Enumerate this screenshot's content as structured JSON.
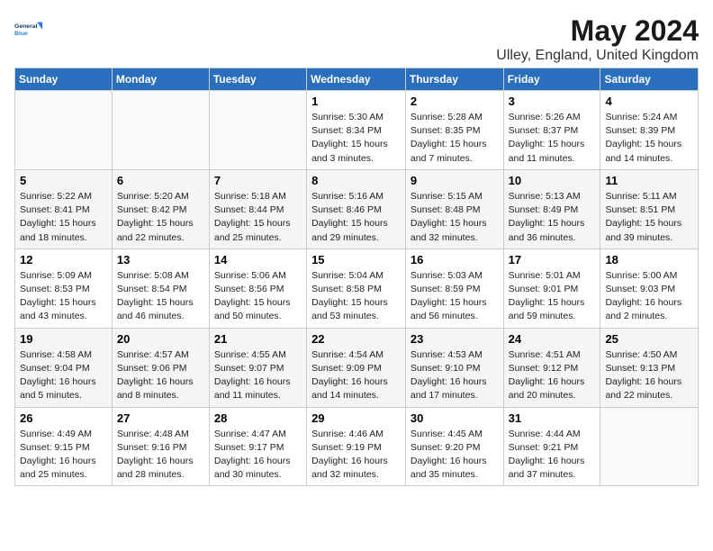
{
  "header": {
    "logo_line1": "General",
    "logo_line2": "Blue",
    "month_year": "May 2024",
    "location": "Ulley, England, United Kingdom"
  },
  "weekdays": [
    "Sunday",
    "Monday",
    "Tuesday",
    "Wednesday",
    "Thursday",
    "Friday",
    "Saturday"
  ],
  "weeks": [
    [
      {
        "day": "",
        "info": ""
      },
      {
        "day": "",
        "info": ""
      },
      {
        "day": "",
        "info": ""
      },
      {
        "day": "1",
        "info": "Sunrise: 5:30 AM\nSunset: 8:34 PM\nDaylight: 15 hours\nand 3 minutes."
      },
      {
        "day": "2",
        "info": "Sunrise: 5:28 AM\nSunset: 8:35 PM\nDaylight: 15 hours\nand 7 minutes."
      },
      {
        "day": "3",
        "info": "Sunrise: 5:26 AM\nSunset: 8:37 PM\nDaylight: 15 hours\nand 11 minutes."
      },
      {
        "day": "4",
        "info": "Sunrise: 5:24 AM\nSunset: 8:39 PM\nDaylight: 15 hours\nand 14 minutes."
      }
    ],
    [
      {
        "day": "5",
        "info": "Sunrise: 5:22 AM\nSunset: 8:41 PM\nDaylight: 15 hours\nand 18 minutes."
      },
      {
        "day": "6",
        "info": "Sunrise: 5:20 AM\nSunset: 8:42 PM\nDaylight: 15 hours\nand 22 minutes."
      },
      {
        "day": "7",
        "info": "Sunrise: 5:18 AM\nSunset: 8:44 PM\nDaylight: 15 hours\nand 25 minutes."
      },
      {
        "day": "8",
        "info": "Sunrise: 5:16 AM\nSunset: 8:46 PM\nDaylight: 15 hours\nand 29 minutes."
      },
      {
        "day": "9",
        "info": "Sunrise: 5:15 AM\nSunset: 8:48 PM\nDaylight: 15 hours\nand 32 minutes."
      },
      {
        "day": "10",
        "info": "Sunrise: 5:13 AM\nSunset: 8:49 PM\nDaylight: 15 hours\nand 36 minutes."
      },
      {
        "day": "11",
        "info": "Sunrise: 5:11 AM\nSunset: 8:51 PM\nDaylight: 15 hours\nand 39 minutes."
      }
    ],
    [
      {
        "day": "12",
        "info": "Sunrise: 5:09 AM\nSunset: 8:53 PM\nDaylight: 15 hours\nand 43 minutes."
      },
      {
        "day": "13",
        "info": "Sunrise: 5:08 AM\nSunset: 8:54 PM\nDaylight: 15 hours\nand 46 minutes."
      },
      {
        "day": "14",
        "info": "Sunrise: 5:06 AM\nSunset: 8:56 PM\nDaylight: 15 hours\nand 50 minutes."
      },
      {
        "day": "15",
        "info": "Sunrise: 5:04 AM\nSunset: 8:58 PM\nDaylight: 15 hours\nand 53 minutes."
      },
      {
        "day": "16",
        "info": "Sunrise: 5:03 AM\nSunset: 8:59 PM\nDaylight: 15 hours\nand 56 minutes."
      },
      {
        "day": "17",
        "info": "Sunrise: 5:01 AM\nSunset: 9:01 PM\nDaylight: 15 hours\nand 59 minutes."
      },
      {
        "day": "18",
        "info": "Sunrise: 5:00 AM\nSunset: 9:03 PM\nDaylight: 16 hours\nand 2 minutes."
      }
    ],
    [
      {
        "day": "19",
        "info": "Sunrise: 4:58 AM\nSunset: 9:04 PM\nDaylight: 16 hours\nand 5 minutes."
      },
      {
        "day": "20",
        "info": "Sunrise: 4:57 AM\nSunset: 9:06 PM\nDaylight: 16 hours\nand 8 minutes."
      },
      {
        "day": "21",
        "info": "Sunrise: 4:55 AM\nSunset: 9:07 PM\nDaylight: 16 hours\nand 11 minutes."
      },
      {
        "day": "22",
        "info": "Sunrise: 4:54 AM\nSunset: 9:09 PM\nDaylight: 16 hours\nand 14 minutes."
      },
      {
        "day": "23",
        "info": "Sunrise: 4:53 AM\nSunset: 9:10 PM\nDaylight: 16 hours\nand 17 minutes."
      },
      {
        "day": "24",
        "info": "Sunrise: 4:51 AM\nSunset: 9:12 PM\nDaylight: 16 hours\nand 20 minutes."
      },
      {
        "day": "25",
        "info": "Sunrise: 4:50 AM\nSunset: 9:13 PM\nDaylight: 16 hours\nand 22 minutes."
      }
    ],
    [
      {
        "day": "26",
        "info": "Sunrise: 4:49 AM\nSunset: 9:15 PM\nDaylight: 16 hours\nand 25 minutes."
      },
      {
        "day": "27",
        "info": "Sunrise: 4:48 AM\nSunset: 9:16 PM\nDaylight: 16 hours\nand 28 minutes."
      },
      {
        "day": "28",
        "info": "Sunrise: 4:47 AM\nSunset: 9:17 PM\nDaylight: 16 hours\nand 30 minutes."
      },
      {
        "day": "29",
        "info": "Sunrise: 4:46 AM\nSunset: 9:19 PM\nDaylight: 16 hours\nand 32 minutes."
      },
      {
        "day": "30",
        "info": "Sunrise: 4:45 AM\nSunset: 9:20 PM\nDaylight: 16 hours\nand 35 minutes."
      },
      {
        "day": "31",
        "info": "Sunrise: 4:44 AM\nSunset: 9:21 PM\nDaylight: 16 hours\nand 37 minutes."
      },
      {
        "day": "",
        "info": ""
      }
    ]
  ]
}
